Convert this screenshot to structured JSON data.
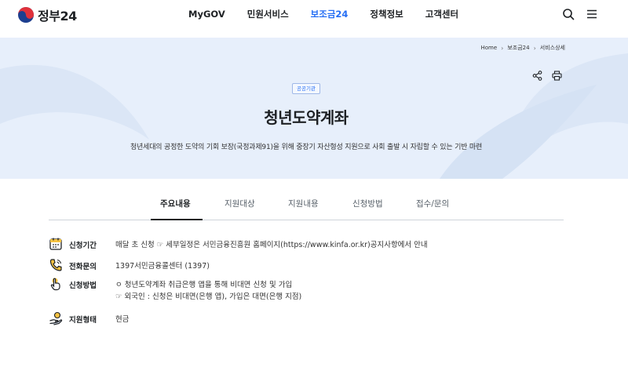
{
  "header": {
    "logo_text": "정부24",
    "nav": [
      "MyGOV",
      "민원서비스",
      "보조금24",
      "정책정보",
      "고객센터"
    ],
    "active_nav_index": 2
  },
  "breadcrumb": [
    "Home",
    "보조금24",
    "서비스상세"
  ],
  "hero": {
    "badge": "공공기관",
    "title": "청년도약계좌",
    "description": "청년세대의 공정한 도약의 기회 보장(국정과제91)을 위해 중장기 자산형성 지원으로 사회 출발 시 자립할 수 있는 기반 마련"
  },
  "tabs": [
    "주요내용",
    "지원대상",
    "지원내용",
    "신청방법",
    "접수/문의"
  ],
  "active_tab_index": 0,
  "info": [
    {
      "icon": "calendar-icon",
      "label": "신청기간",
      "lines": [
        "매달 초 신청 ☞ 세부일정은 서민금융진흥원 홈페이지(https://www.kinfa.or.kr)공지사항에서 안내"
      ]
    },
    {
      "icon": "phone-icon",
      "label": "전화문의",
      "lines": [
        "1397서민금융콜센터 (1397)"
      ]
    },
    {
      "icon": "hand-pointer-icon",
      "label": "신청방법",
      "lines": [
        "ㅇ 청년도약계좌 취급은행 앱을 통해 비대면 신청 및 가입",
        "☞ 외국인 : 신청은 비대면(은행 앱), 가입은 대면(은행 지점)"
      ]
    },
    {
      "icon": "money-hand-icon",
      "label": "지원형태",
      "lines": [
        "현금"
      ]
    }
  ],
  "colors": {
    "accent": "#256ef4",
    "hero_bg": "#e7effb",
    "text": "#1e2124"
  }
}
